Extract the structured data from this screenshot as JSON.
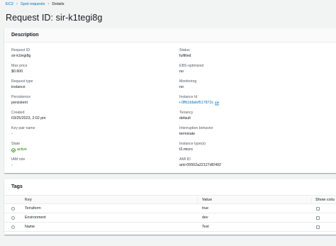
{
  "breadcrumb": {
    "items": [
      {
        "label": "EC2"
      },
      {
        "label": "Spot requests"
      },
      {
        "label": "Details"
      }
    ],
    "separator": "›"
  },
  "page": {
    "title": "Request ID: sir-k1tegi8g"
  },
  "description": {
    "header": "Description",
    "left": [
      {
        "label": "Request ID",
        "value": "sir-k1tegi8g"
      },
      {
        "label": "Max price",
        "value": "$0.600"
      },
      {
        "label": "Request type",
        "value": "instance"
      },
      {
        "label": "Persistence",
        "value": "persistent"
      },
      {
        "label": "Created",
        "value": "03/25/2023, 2:02 pm"
      },
      {
        "label": "Key pair name",
        "value": "-"
      },
      {
        "label": "State",
        "value": "active"
      },
      {
        "label": "IAM role",
        "value": "-"
      }
    ],
    "right": [
      {
        "label": "Status",
        "value": "fulfilled"
      },
      {
        "label": "EBS-optimized",
        "value": "no"
      },
      {
        "label": "Monitoring",
        "value": "no"
      },
      {
        "label": "Instance Id",
        "value": "i-0ffb1bbdef517872c"
      },
      {
        "label": "Tenancy",
        "value": "default"
      },
      {
        "label": "Interruption behavior",
        "value": "terminate"
      },
      {
        "label": "Instance type(s)",
        "value": "t2.micro"
      },
      {
        "label": "AMI ID",
        "value": "ami-05502a22127df2492"
      }
    ]
  },
  "tags": {
    "header": "Tags",
    "columns": {
      "key": "Key",
      "value": "Value",
      "show": "Show colu"
    },
    "rows": [
      {
        "key": "Terraform",
        "value": "true"
      },
      {
        "key": "Environment",
        "value": "dev"
      },
      {
        "key": "Name",
        "value": "Test"
      }
    ]
  },
  "colors": {
    "link": "#0073bb",
    "success": "#1d8102",
    "background": "#f2f3f3"
  }
}
